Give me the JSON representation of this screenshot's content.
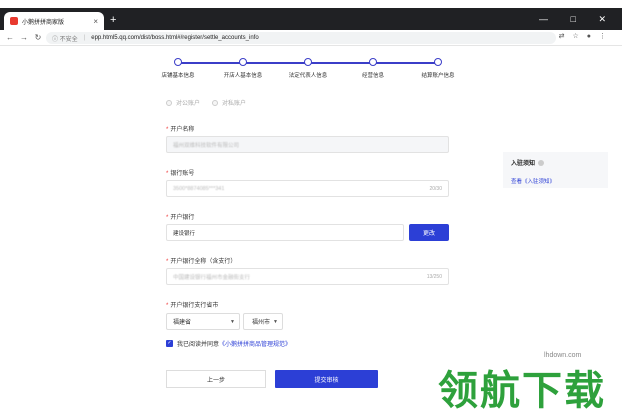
{
  "browser": {
    "tab_title": "小鹅拼拼商家版",
    "new_tab": "+",
    "security": "不安全",
    "url": "epp.html5.qq.com/dist/boss.html#/register/settle_accounts_info"
  },
  "steps": [
    "店铺基本信息",
    "开店人基本信息",
    "法定代表人信息",
    "经营信息",
    "结算账户信息"
  ],
  "form": {
    "radio_public": "对公账户",
    "radio_private": "对私账户",
    "account_name_label": "开户名称",
    "account_name_value": "福州双维科技软件有限公司",
    "bank_no_label": "银行账号",
    "bank_no_value": "3500*8874085***341",
    "bank_no_count": "20/30",
    "bank_label": "开户银行",
    "bank_value": "建设银行",
    "change_button": "更改",
    "branch_label": "开户银行全称（含支行）",
    "branch_value": "中国建设银行福州市金融街支行",
    "branch_count": "13/250",
    "region_label": "开户银行支行省市",
    "province": "福建省",
    "city": "福州市",
    "agree_prefix": "我已阅读并同意",
    "agree_link": "《小鹅拼拼商品管理规范》",
    "prev_button": "上一步",
    "submit_button": "提交审核"
  },
  "notice": {
    "title": "入驻须知",
    "link": "查看《入驻须知》"
  },
  "watermark": {
    "site": "lhdown.com",
    "text": "领航下载"
  },
  "colors": {
    "accent": "#2c3fd6",
    "watermark": "#2ea13c"
  }
}
